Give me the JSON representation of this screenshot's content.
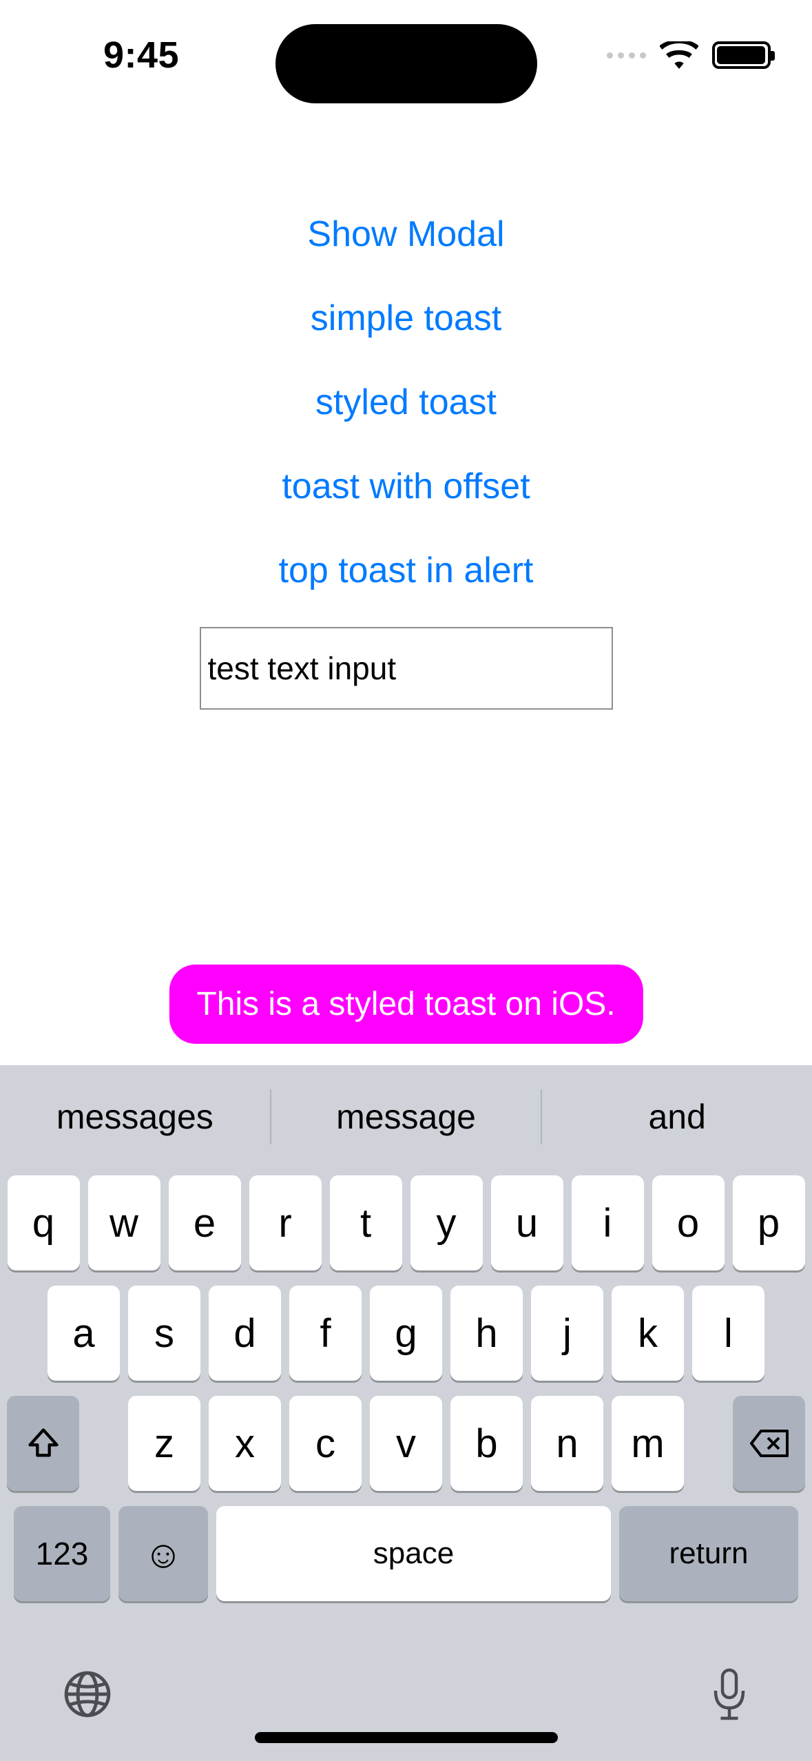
{
  "status": {
    "time": "9:45"
  },
  "buttons": {
    "show_modal": "Show Modal",
    "simple_toast": "simple toast",
    "styled_toast": "styled toast",
    "toast_offset": "toast with offset",
    "top_toast_alert": "top toast in alert"
  },
  "input": {
    "value": "test text input"
  },
  "toast": {
    "text": "This is a styled toast on iOS.",
    "bg_color": "#ff00ff",
    "text_color": "#ffffff"
  },
  "keyboard": {
    "predictions": [
      "messages",
      "message",
      "and"
    ],
    "row1": [
      "q",
      "w",
      "e",
      "r",
      "t",
      "y",
      "u",
      "i",
      "o",
      "p"
    ],
    "row2": [
      "a",
      "s",
      "d",
      "f",
      "g",
      "h",
      "j",
      "k",
      "l"
    ],
    "row3": [
      "z",
      "x",
      "c",
      "v",
      "b",
      "n",
      "m"
    ],
    "numeric_label": "123",
    "space_label": "space",
    "return_label": "return"
  }
}
